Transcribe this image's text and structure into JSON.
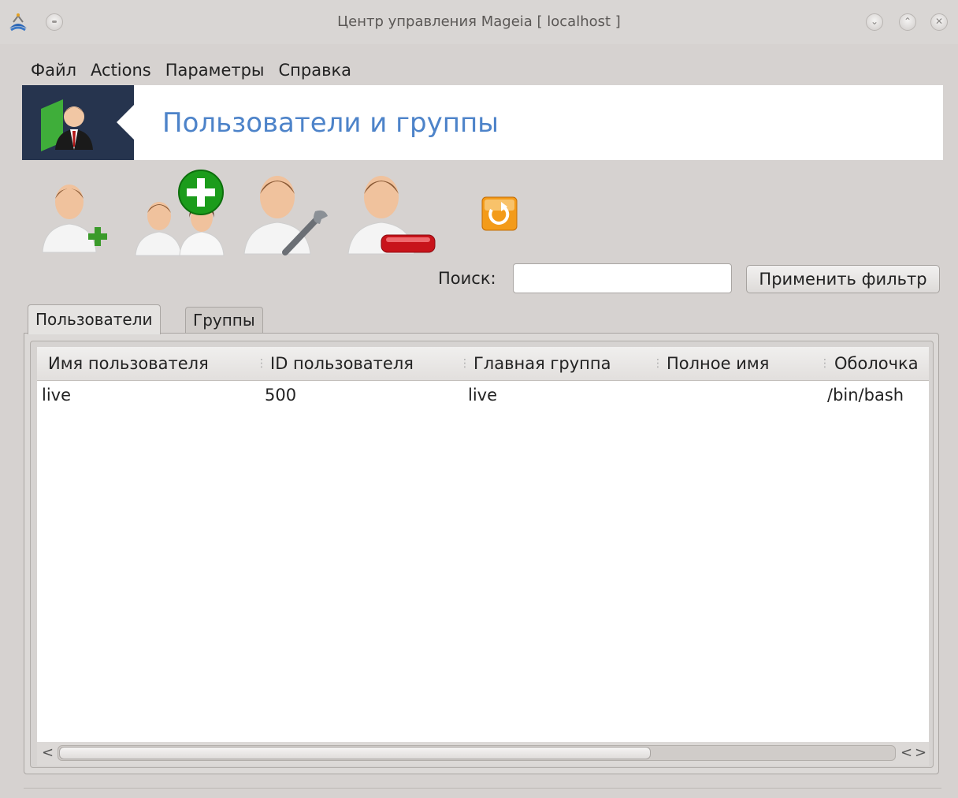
{
  "window": {
    "title": "Центр управления Mageia  [ localhost ]"
  },
  "menu": [
    "Файл",
    "Actions",
    "Параметры",
    "Справка"
  ],
  "banner": {
    "title": "Пользователи и группы"
  },
  "toolbar": {
    "buttons": [
      {
        "icon": "add-user-icon"
      },
      {
        "icon": "add-group-icon"
      },
      {
        "icon": "edit-user-icon"
      },
      {
        "icon": "delete-user-icon"
      },
      {
        "icon": "refresh-icon"
      }
    ]
  },
  "search": {
    "label": "Поиск:",
    "value": "",
    "apply_label": "Применить фильтр"
  },
  "tabs": [
    {
      "label": "Пользователи",
      "active": true
    },
    {
      "label": "Группы",
      "active": false
    }
  ],
  "table": {
    "columns": [
      "Имя пользователя",
      "ID пользователя",
      "Главная группа",
      "Полное имя",
      "Оболочка"
    ],
    "rows": [
      [
        "live",
        "500",
        "live",
        "",
        "/bin/bash"
      ]
    ]
  },
  "scrollbar": {
    "fraction_visible": 0.7
  },
  "colors": {
    "banner_title": "#4d83c9",
    "banner_icon_bg": "#26344e"
  }
}
